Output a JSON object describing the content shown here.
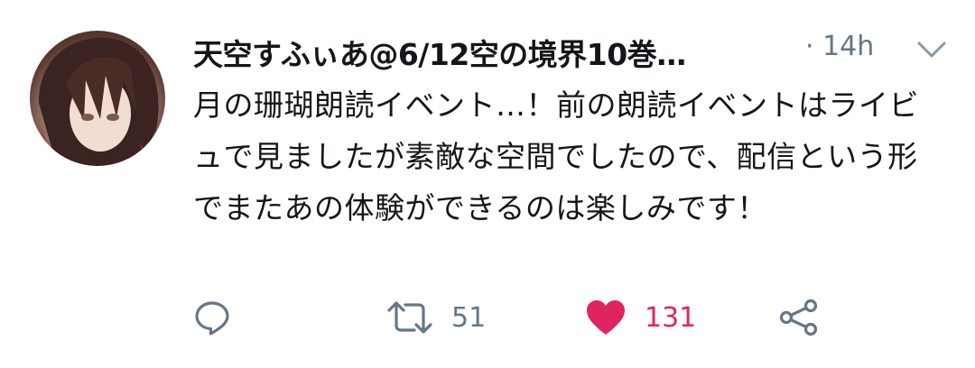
{
  "tweet": {
    "display_name": "天空すふぃあ@6/12空の境界10巻…",
    "separator": "·",
    "time": "14h",
    "text": "月の珊瑚朗読イベント…！前の朗読イベントはライビュで見ましたが素敵な空間でしたので、配信という形でまたあの体験ができるのは楽しみです！",
    "retweet_count": "51",
    "like_count": "131"
  },
  "icons": {
    "caret": "chevron-down-icon",
    "reply": "reply-icon",
    "retweet": "retweet-icon",
    "like": "heart-icon",
    "share": "share-icon"
  },
  "colors": {
    "like": "#e0245e",
    "muted": "#657786",
    "text": "#14171a"
  }
}
